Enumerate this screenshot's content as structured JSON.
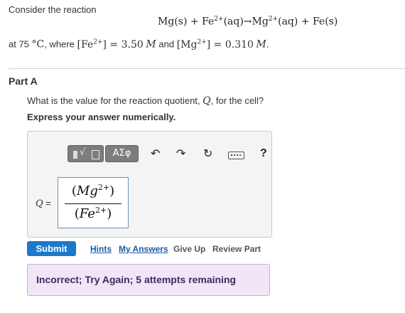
{
  "problem": {
    "intro": "Consider the reaction",
    "equation": {
      "reactant1": "Mg(s) + Fe",
      "reactant1_charge": "2+",
      "middle": "(aq)→Mg",
      "product1_charge": "2+",
      "end": "(aq) + Fe(s)"
    },
    "conditions": {
      "prefix": "at 75",
      "degree": "°C",
      "where": ", where",
      "fe_ion": "[Fe",
      "fe_charge": "2+",
      "fe_value": "] = 3.50",
      "unit1": "M",
      "and": "and",
      "mg_ion": "[Mg",
      "mg_charge": "2+",
      "mg_value": "] = 0.310",
      "unit2": "M",
      "end": "."
    }
  },
  "part": {
    "title": "Part A",
    "question_prefix": "What is the value for the reaction quotient,",
    "question_var": "Q",
    "question_suffix": ", for the cell?",
    "instruction": "Express your answer numerically."
  },
  "toolbar": {
    "symbols_label": "ΑΣφ",
    "undo_glyph": "↶",
    "redo_glyph": "↷",
    "reset_glyph": "↻",
    "help_label": "?"
  },
  "answer": {
    "var": "Q",
    "equals": " =",
    "numerator": {
      "open": "(",
      "var": "Mg",
      "charge": "2+",
      "close": ")"
    },
    "denominator": {
      "open": "(",
      "var": "Fe",
      "charge": "2+",
      "close": ")"
    }
  },
  "actions": {
    "submit": "Submit",
    "hints": "Hints",
    "my_answers": "My Answers",
    "give_up": "Give Up",
    "review_part": "Review Part"
  },
  "feedback": {
    "message": "Incorrect; Try Again; 5 attempts remaining"
  },
  "colors": {
    "submit_bg": "#1c78c8",
    "feedback_bg": "#f1e6f8",
    "feedback_border": "#c7aee0",
    "link": "#1a5ba8"
  }
}
